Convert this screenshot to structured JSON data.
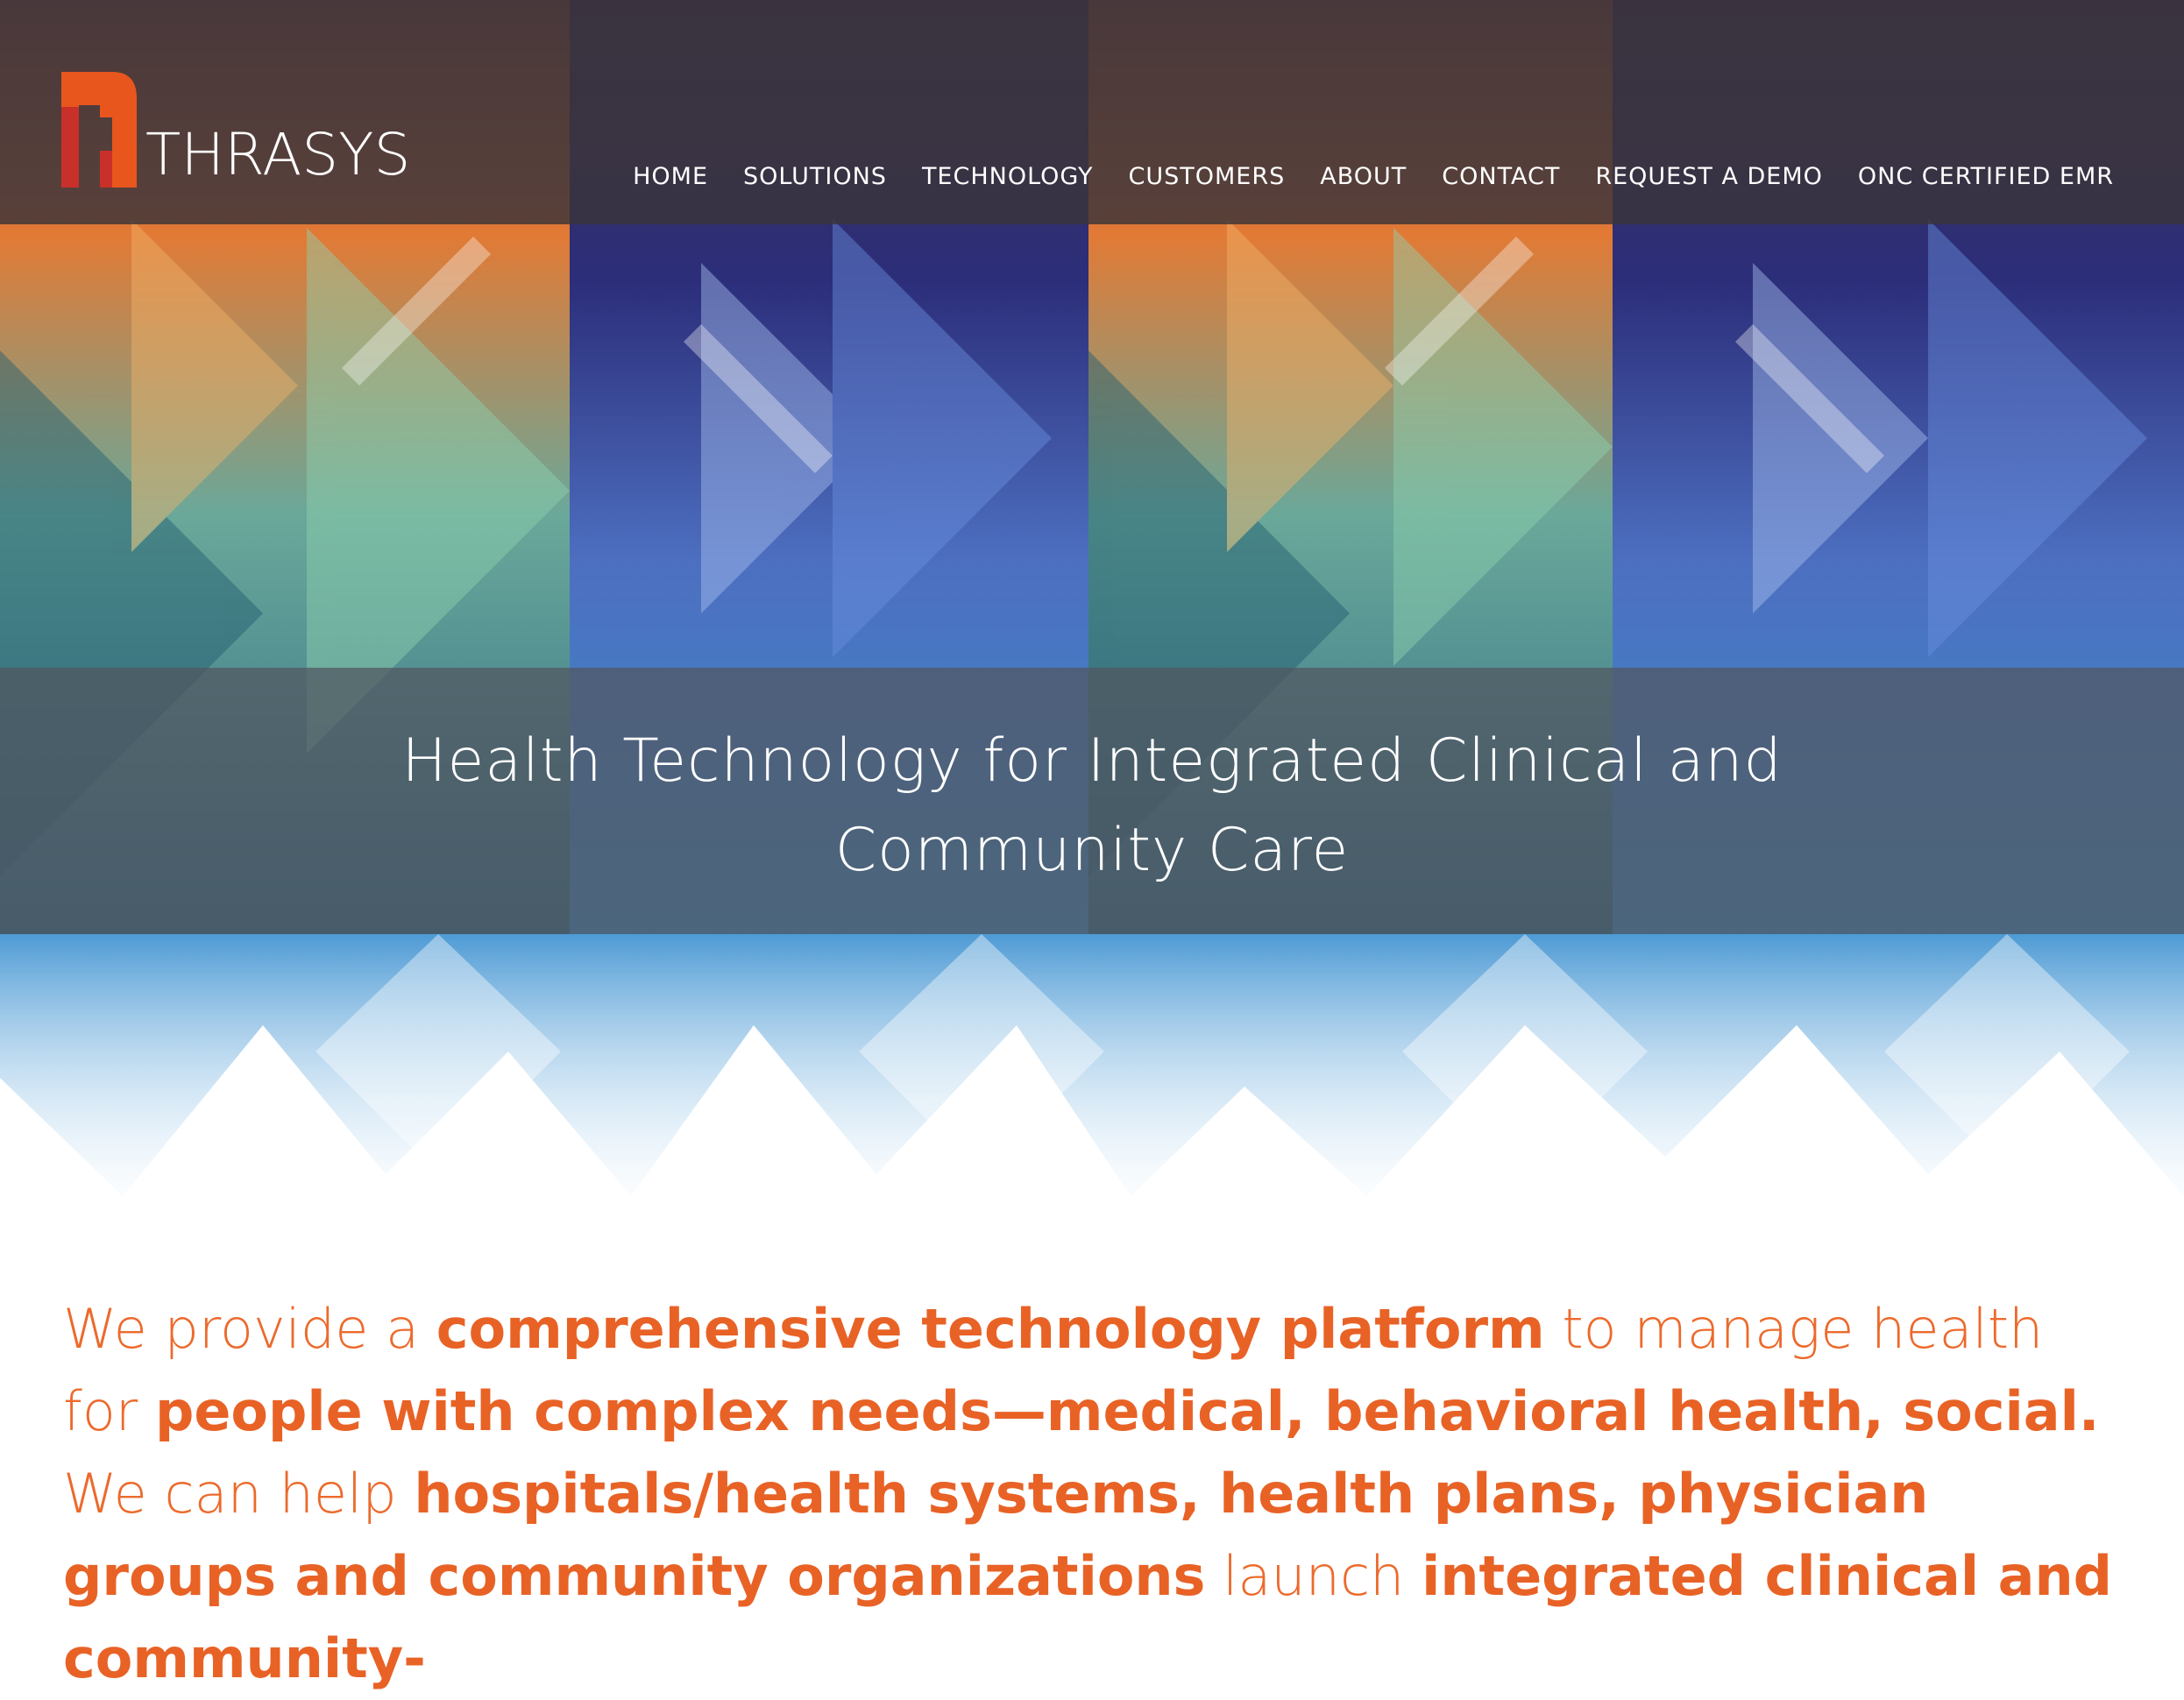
{
  "brand": {
    "name": "THRASYS",
    "colors": {
      "orange": "#ec6a2c",
      "red": "#d63a2a",
      "header_bg": "#3a343a"
    }
  },
  "nav": {
    "items": [
      {
        "label": "HOME"
      },
      {
        "label": "SOLUTIONS"
      },
      {
        "label": "TECHNOLOGY"
      },
      {
        "label": "CUSTOMERS"
      },
      {
        "label": "ABOUT"
      },
      {
        "label": "CONTACT"
      },
      {
        "label": "REQUEST A DEMO"
      },
      {
        "label": "ONC CERTIFIED EMR"
      }
    ]
  },
  "hero": {
    "tagline_line1": "Health Technology for Integrated Clinical and",
    "tagline_line2": "Community Care"
  },
  "intro": {
    "p1": "We provide a ",
    "b1": "comprehensive technology platform",
    "p2": " to manage health for ",
    "b2": "people with complex needs—medical, behavioral health, social.",
    "p3": " We can help ",
    "b3": "hospitals/health systems, health plans, physician groups and community organizations",
    "p4": " launch ",
    "b4": "integrated clinical and community-"
  }
}
